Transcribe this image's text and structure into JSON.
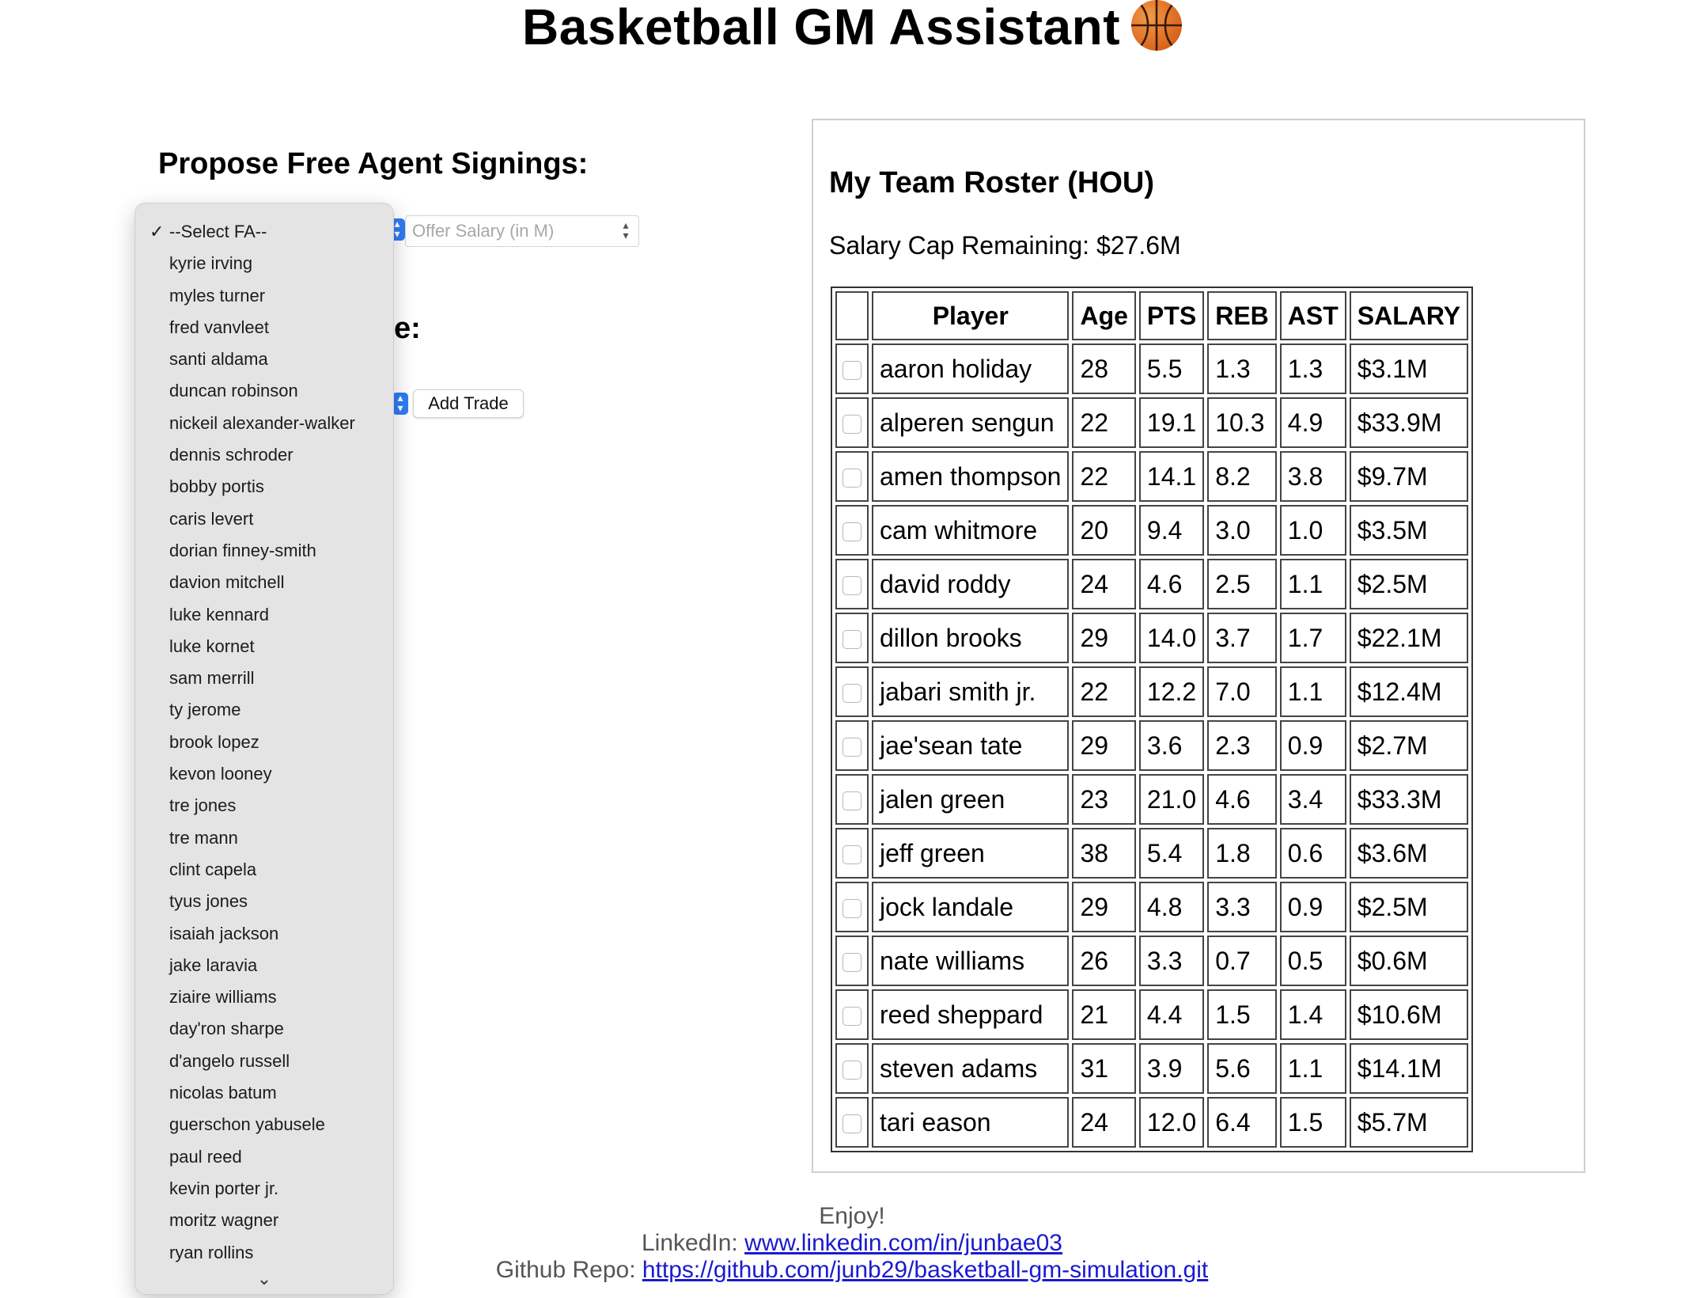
{
  "header": {
    "title": "Basketball GM Assistant",
    "icon": "basketball-icon"
  },
  "free_agent": {
    "heading": "Propose Free Agent Signings:",
    "select_selected": "--Select FA--",
    "options": [
      "--Select FA--",
      "kyrie irving",
      "myles turner",
      "fred vanvleet",
      "santi aldama",
      "duncan robinson",
      "nickeil alexander-walker",
      "dennis schroder",
      "bobby portis",
      "caris levert",
      "dorian finney-smith",
      "davion mitchell",
      "luke kennard",
      "luke kornet",
      "sam merrill",
      "ty jerome",
      "brook lopez",
      "kevon looney",
      "tre jones",
      "tre mann",
      "clint capela",
      "tyus jones",
      "isaiah jackson",
      "jake laravia",
      "ziaire williams",
      "day'ron sharpe",
      "d'angelo russell",
      "nicolas batum",
      "guerschon yabusele",
      "paul reed",
      "kevin porter jr.",
      "moritz wagner",
      "ryan rollins"
    ],
    "salary_placeholder": "Offer Salary (in M)",
    "dropdown_more": "⌄"
  },
  "trade": {
    "heading_visible": "e:",
    "add_button": "Add Trade"
  },
  "roster": {
    "heading": "My Team Roster (HOU)",
    "cap_remaining": "Salary Cap Remaining: $27.6M",
    "columns": [
      "",
      "Player",
      "Age",
      "PTS",
      "REB",
      "AST",
      "SALARY"
    ],
    "rows": [
      [
        "aaron holiday",
        "28",
        "5.5",
        "1.3",
        "1.3",
        "$3.1M"
      ],
      [
        "alperen sengun",
        "22",
        "19.1",
        "10.3",
        "4.9",
        "$33.9M"
      ],
      [
        "amen thompson",
        "22",
        "14.1",
        "8.2",
        "3.8",
        "$9.7M"
      ],
      [
        "cam whitmore",
        "20",
        "9.4",
        "3.0",
        "1.0",
        "$3.5M"
      ],
      [
        "david roddy",
        "24",
        "4.6",
        "2.5",
        "1.1",
        "$2.5M"
      ],
      [
        "dillon brooks",
        "29",
        "14.0",
        "3.7",
        "1.7",
        "$22.1M"
      ],
      [
        "jabari smith jr.",
        "22",
        "12.2",
        "7.0",
        "1.1",
        "$12.4M"
      ],
      [
        "jae'sean tate",
        "29",
        "3.6",
        "2.3",
        "0.9",
        "$2.7M"
      ],
      [
        "jalen green",
        "23",
        "21.0",
        "4.6",
        "3.4",
        "$33.3M"
      ],
      [
        "jeff green",
        "38",
        "5.4",
        "1.8",
        "0.6",
        "$3.6M"
      ],
      [
        "jock landale",
        "29",
        "4.8",
        "3.3",
        "0.9",
        "$2.5M"
      ],
      [
        "nate williams",
        "26",
        "3.3",
        "0.7",
        "0.5",
        "$0.6M"
      ],
      [
        "reed sheppard",
        "21",
        "4.4",
        "1.5",
        "1.4",
        "$10.6M"
      ],
      [
        "steven adams",
        "31",
        "3.9",
        "5.6",
        "1.1",
        "$14.1M"
      ],
      [
        "tari eason",
        "24",
        "12.0",
        "6.4",
        "1.5",
        "$5.7M"
      ]
    ]
  },
  "footer": {
    "enjoy": "Enjoy!",
    "linkedin_label": "LinkedIn: ",
    "linkedin_url": "www.linkedin.com/in/junbae03",
    "github_label": "Github Repo: ",
    "github_url": "https://github.com/junb29/basketball-gm-simulation.git"
  },
  "colors": {
    "link": "#1a1acf",
    "select_accent": "#2f7cf6",
    "dropdown_bg": "#e4e4e4"
  }
}
